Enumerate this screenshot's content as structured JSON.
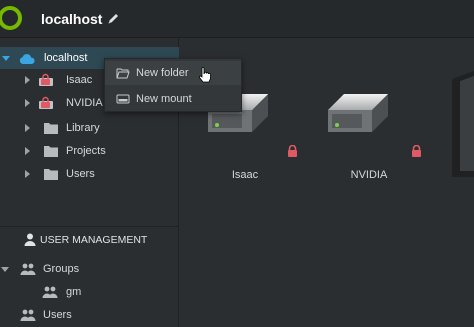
{
  "header": {
    "title": "localhost"
  },
  "sidebar": {
    "root": {
      "label": "localhost"
    },
    "items": [
      {
        "label": "Isaac",
        "icon": "lock-drive-icon"
      },
      {
        "label": "NVIDIA",
        "icon": "lock-drive-icon"
      },
      {
        "label": "Library",
        "icon": "folder-icon"
      },
      {
        "label": "Projects",
        "icon": "folder-icon"
      },
      {
        "label": "Users",
        "icon": "folder-icon"
      }
    ],
    "user_management": {
      "title": "USER MANAGEMENT",
      "groups_label": "Groups",
      "group_items": [
        {
          "label": "gm"
        }
      ],
      "users_label": "Users"
    }
  },
  "context_menu": {
    "items": [
      {
        "label": "New folder"
      },
      {
        "label": "New mount"
      }
    ]
  },
  "main": {
    "drives": [
      {
        "label": "Isaac",
        "locked": true
      },
      {
        "label": "NVIDIA",
        "locked": true
      }
    ]
  },
  "colors": {
    "accent": "#3aa5e0",
    "selection": "#2e4954",
    "lock": "#e05a66",
    "logo": "#76b900"
  }
}
